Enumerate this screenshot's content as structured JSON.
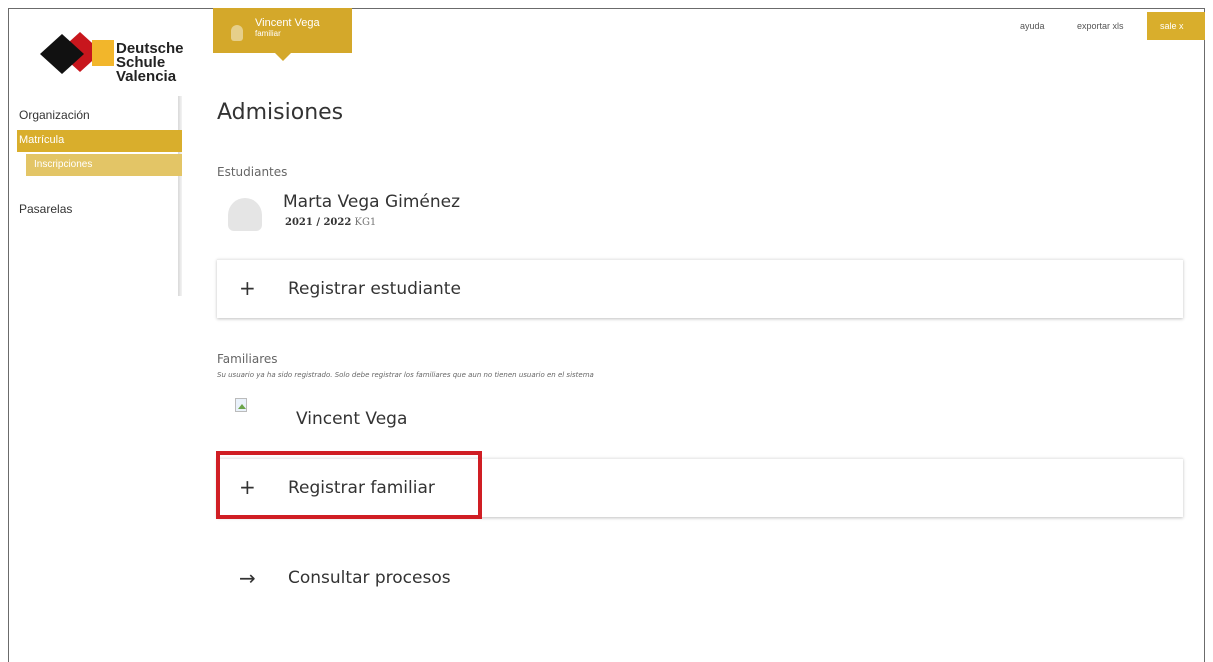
{
  "app": {
    "logo_text_1": "Deutsche",
    "logo_text_2": "Schule",
    "logo_text_3": "Valencia",
    "brand_color": "#d9ae2c",
    "highlight_color": "#d01e24"
  },
  "sidebar": {
    "items": [
      {
        "label": "Organización"
      },
      {
        "label": "Matrícula"
      },
      {
        "label": "Inscripciones"
      },
      {
        "label": "Pasarelas"
      }
    ]
  },
  "user_tab": {
    "name": "Vincent Vega",
    "role": "familiar"
  },
  "top_links": {
    "help": "ayuda",
    "export": "exportar xls",
    "logout": "sale x"
  },
  "main": {
    "title": "Admisiones",
    "students_label": "Estudiantes",
    "student": {
      "name": "Marta Vega Giménez",
      "year": "2021 / 2022",
      "group": "KG1"
    },
    "register_student": "Registrar estudiante",
    "family_label": "Familiares",
    "family_note": "Su usuario ya ha sido registrado. Solo debe registrar los familiares que aun no tienen usuario en el sistema",
    "family_member": "Vincent Vega",
    "register_family": "Registrar familiar",
    "consult_processes": "Consultar procesos",
    "icons": {
      "plus": "+",
      "arrow": "→"
    }
  }
}
